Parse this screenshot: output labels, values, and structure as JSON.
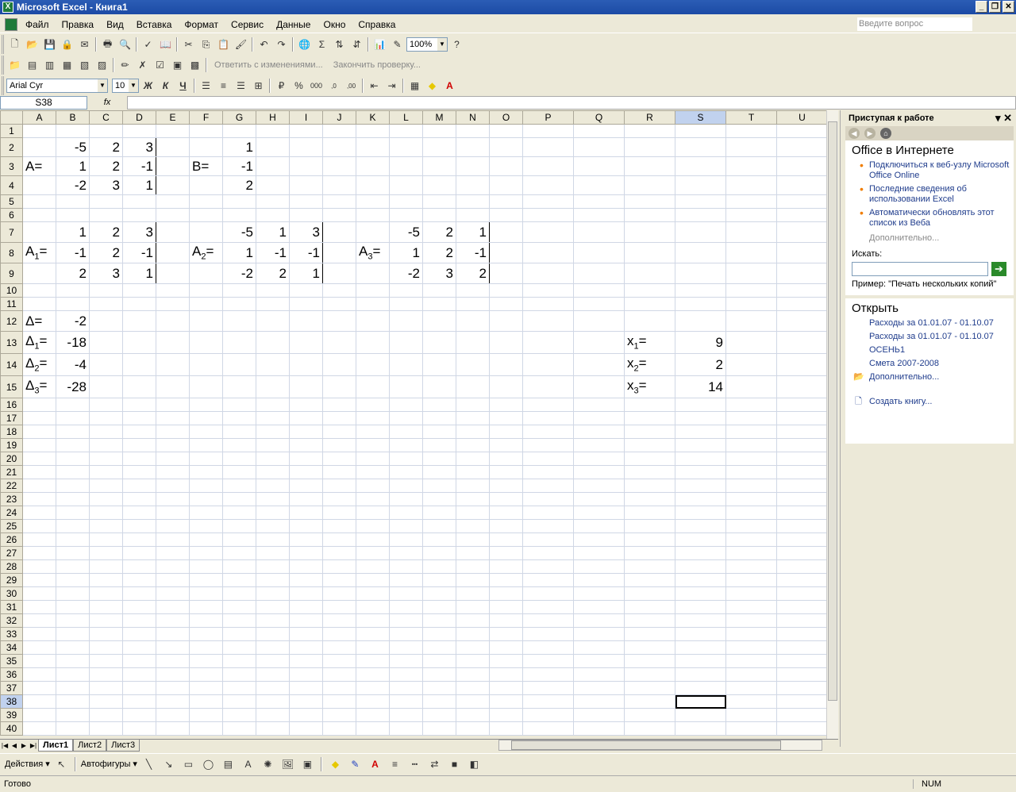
{
  "title": "Microsoft Excel - Книга1",
  "menu": [
    "Файл",
    "Правка",
    "Вид",
    "Вставка",
    "Формат",
    "Сервис",
    "Данные",
    "Окно",
    "Справка"
  ],
  "ask_placeholder": "Введите вопрос",
  "zoom": "100%",
  "review_reply": "Ответить с изменениями...",
  "review_end": "Закончить проверку...",
  "font_name": "Arial Cyr",
  "font_size": "10",
  "name_box": "S38",
  "fx": "fx",
  "cols": [
    "A",
    "B",
    "C",
    "D",
    "E",
    "F",
    "G",
    "H",
    "I",
    "J",
    "K",
    "L",
    "M",
    "N",
    "O",
    "P",
    "Q",
    "R",
    "S",
    "T",
    "U"
  ],
  "rows": {
    "r2": {
      "B": "-5",
      "C": "2",
      "D": "3",
      "G": "1"
    },
    "r3": {
      "A": "A=",
      "B": "1",
      "C": "2",
      "D": "-1",
      "F": "B=",
      "G": "-1"
    },
    "r4": {
      "B": "-2",
      "C": "3",
      "D": "1",
      "G": "2"
    },
    "r7": {
      "B": "1",
      "C": "2",
      "D": "3",
      "G": "-5",
      "H": "1",
      "I": "3",
      "L": "-5",
      "M": "2",
      "N": "1"
    },
    "r8": {
      "A1": "A",
      "A1sub": "1",
      "A1eq": "=",
      "B": "-1",
      "C": "2",
      "D": "-1",
      "F1": "A",
      "F1sub": "2",
      "F1eq": "=",
      "G": "1",
      "H": "-1",
      "I": "-1",
      "K1": "A",
      "K1sub": "3",
      "K1eq": "=",
      "L": "1",
      "M": "2",
      "N": "-1"
    },
    "r9": {
      "B": "2",
      "C": "3",
      "D": "1",
      "G": "-2",
      "H": "2",
      "I": "1",
      "L": "-2",
      "M": "3",
      "N": "2"
    },
    "r12": {
      "A": "Δ=",
      "B": "-2"
    },
    "r13": {
      "A1": "Δ",
      "Asub": "1",
      "Aeq": "=",
      "B": "-18",
      "R1": "x",
      "Rsub": "1",
      "Req": "=",
      "S": "9"
    },
    "r14": {
      "A1": "Δ",
      "Asub": "2",
      "Aeq": "=",
      "B": "-4",
      "R1": "x",
      "Rsub": "2",
      "Req": "=",
      "S": "2"
    },
    "r15": {
      "A1": "Δ",
      "Asub": "3",
      "Aeq": "=",
      "B": "-28",
      "R1": "x",
      "Rsub": "3",
      "Req": "=",
      "S": "14"
    }
  },
  "sheets": [
    "Лист1",
    "Лист2",
    "Лист3"
  ],
  "taskpane": {
    "header": "Приступая к работе",
    "section_online": "Office в Интернете",
    "links": [
      "Подключиться к веб-узлу Microsoft Office Online",
      "Последние сведения об использовании Excel",
      "Автоматически обновлять этот список из Веба"
    ],
    "more": "Дополнительно...",
    "search_label": "Искать:",
    "example": "Пример:  \"Печать нескольких копий\"",
    "section_open": "Открыть",
    "files": [
      "Расходы за 01.01.07 - 01.10.07",
      "Расходы за 01.01.07 - 01.10.07",
      "ОСЕНЬ1",
      "Смета 2007-2008"
    ],
    "open_more": "Дополнительно...",
    "create": "Создать книгу..."
  },
  "draw": {
    "actions": "Действия",
    "autoshapes": "Автофигуры"
  },
  "status": "Готово",
  "num": "NUM"
}
